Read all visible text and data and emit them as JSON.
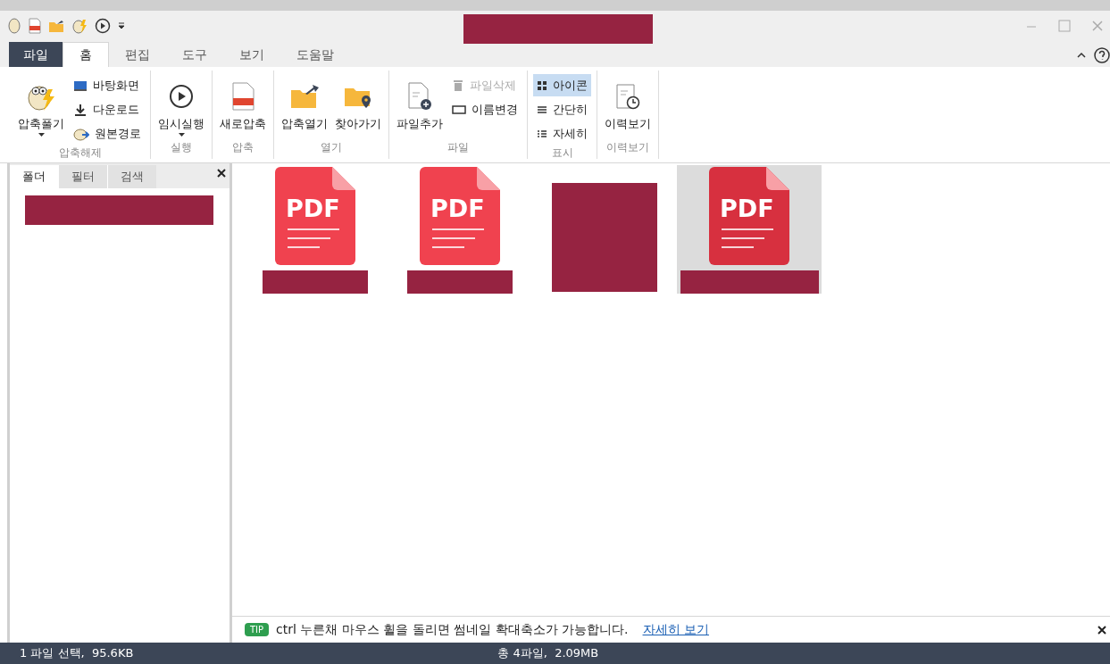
{
  "menu_tabs": [
    {
      "label": "파일",
      "kind": "file",
      "selected": false
    },
    {
      "label": "홈",
      "kind": "tab",
      "selected": true
    },
    {
      "label": "편집",
      "kind": "tab",
      "selected": false
    },
    {
      "label": "도구",
      "kind": "tab",
      "selected": false
    },
    {
      "label": "보기",
      "kind": "tab",
      "selected": false
    },
    {
      "label": "도움말",
      "kind": "tab",
      "selected": false
    }
  ],
  "ribbon_groups": [
    {
      "label": "압축해제",
      "items": [
        {
          "kind": "large",
          "label": "압축풀기",
          "dropdown": true
        },
        {
          "kind": "small",
          "label": "바탕화면",
          "disabled": false,
          "selected": false
        },
        {
          "kind": "small",
          "label": "다운로드",
          "disabled": false,
          "selected": false
        },
        {
          "kind": "small",
          "label": "원본경로",
          "disabled": false,
          "selected": false
        }
      ]
    },
    {
      "label": "실행",
      "items": [
        {
          "kind": "large",
          "label": "임시실행",
          "dropdown": true
        }
      ]
    },
    {
      "label": "압축",
      "items": [
        {
          "kind": "large",
          "label": "새로압축",
          "dropdown": false
        }
      ]
    },
    {
      "label": "열기",
      "items": [
        {
          "kind": "large",
          "label": "압축열기",
          "dropdown": false
        },
        {
          "kind": "large",
          "label": "찾아가기",
          "dropdown": false
        }
      ]
    },
    {
      "label": "파일",
      "items": [
        {
          "kind": "large",
          "label": "파일추가",
          "dropdown": false
        },
        {
          "kind": "small",
          "label": "파일삭제",
          "disabled": true,
          "selected": false
        },
        {
          "kind": "small",
          "label": "이름변경",
          "disabled": false,
          "selected": false
        }
      ]
    },
    {
      "label": "표시",
      "items": [
        {
          "kind": "small",
          "label": "아이콘",
          "disabled": false,
          "selected": true
        },
        {
          "kind": "small",
          "label": "간단히",
          "disabled": false,
          "selected": false
        },
        {
          "kind": "small",
          "label": "자세히",
          "disabled": false,
          "selected": false
        }
      ]
    },
    {
      "label": "이력보기",
      "items": [
        {
          "kind": "large",
          "label": "이력보기",
          "dropdown": false
        }
      ]
    }
  ],
  "side_tabs": [
    {
      "label": "폴더",
      "selected": true
    },
    {
      "label": "필터",
      "selected": false
    },
    {
      "label": "검색",
      "selected": false
    }
  ],
  "files": [
    {
      "kind": "pdf",
      "label": "PDF",
      "selected": false
    },
    {
      "kind": "pdf",
      "label": "PDF",
      "selected": false
    },
    {
      "kind": "redacted",
      "selected": false
    },
    {
      "kind": "pdf",
      "label": "PDF",
      "selected": true
    }
  ],
  "tip": {
    "badge": "TIP",
    "text": "ctrl 누른채 마우스 휠을 돌리면 썸네일 확대축소가 가능합니다.",
    "link": "자세히 보기"
  },
  "status_bar": {
    "left": "1 파일 선택,  95.6KB",
    "right": "총 4파일,  2.09MB"
  }
}
